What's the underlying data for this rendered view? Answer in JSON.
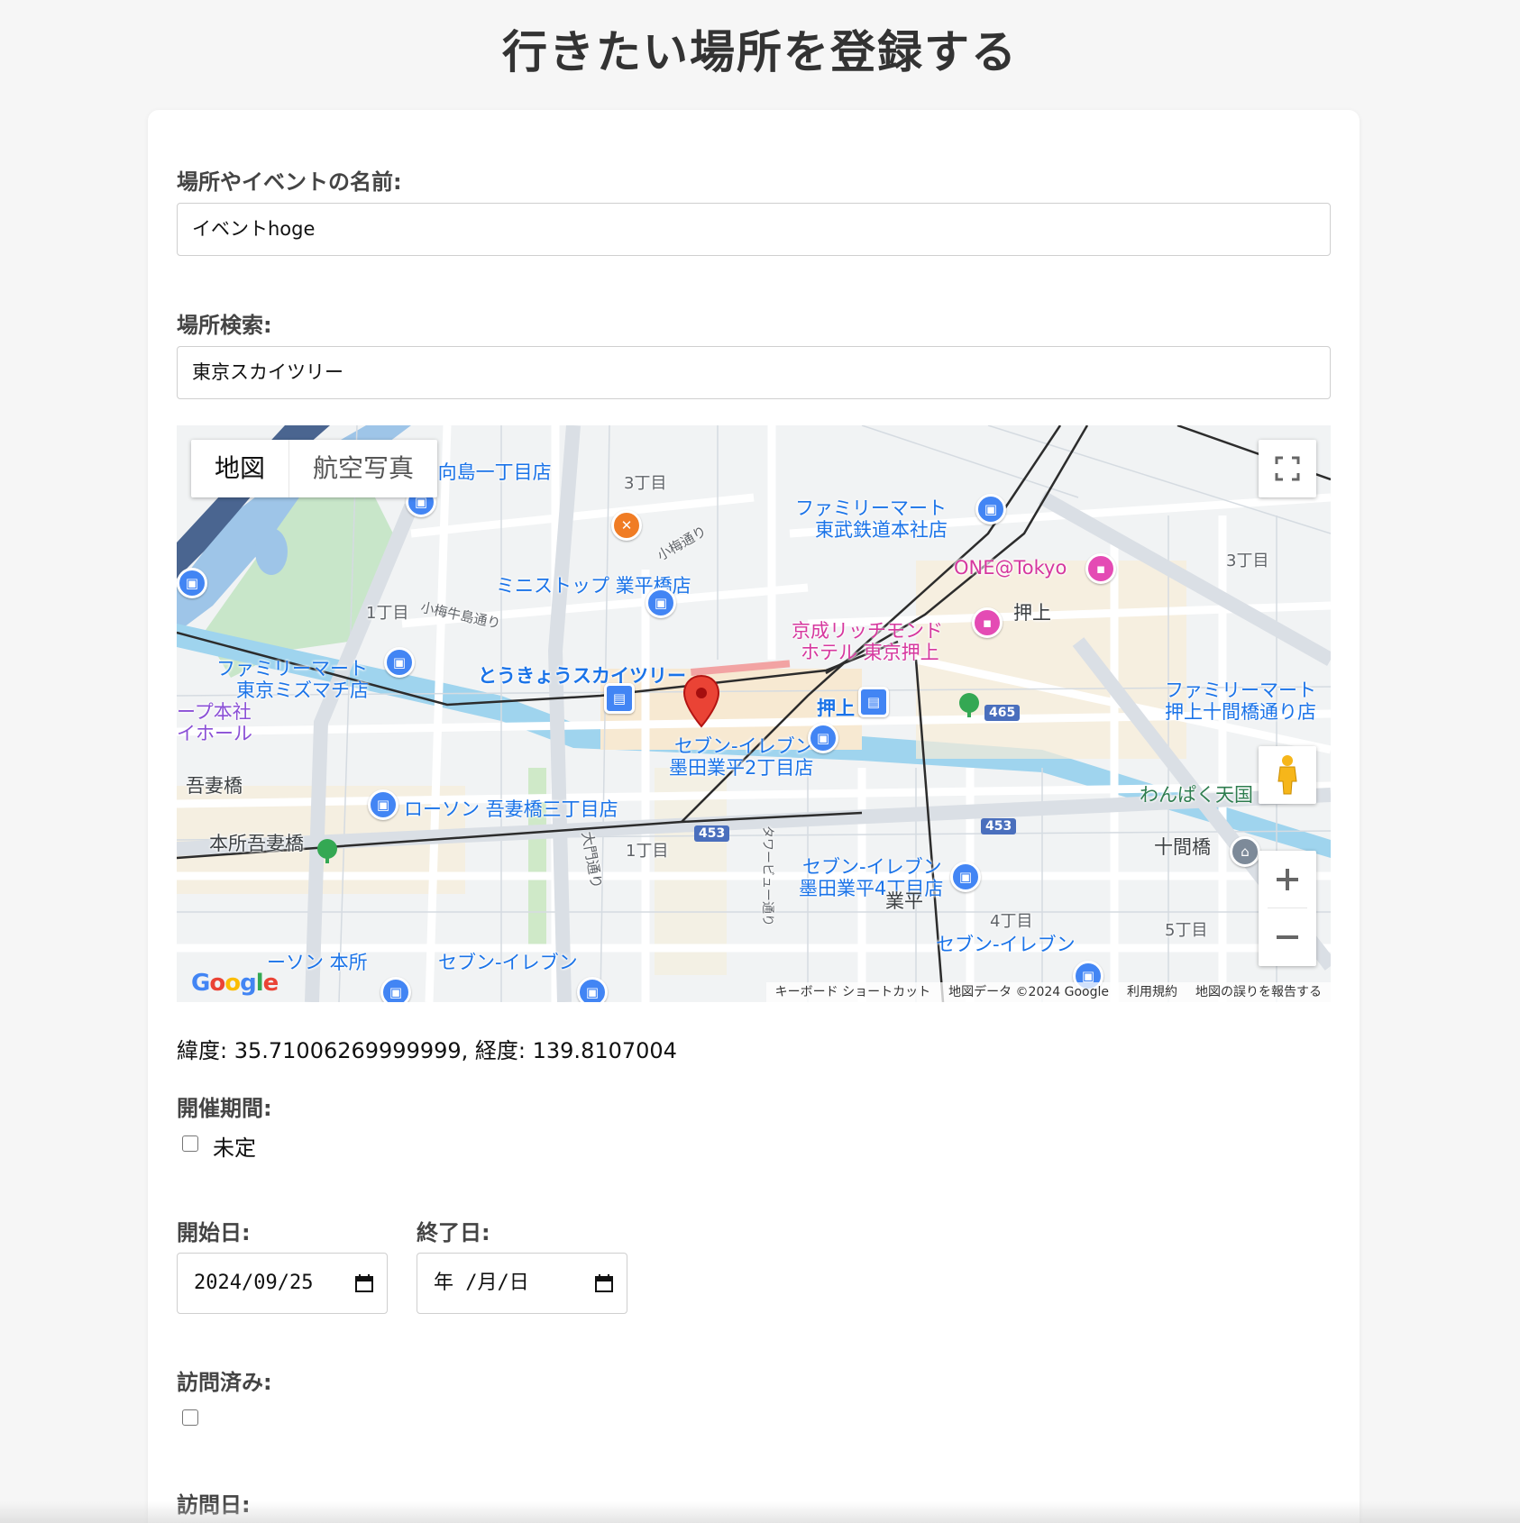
{
  "page": {
    "title": "行きたい場所を登録する"
  },
  "form": {
    "name_label": "場所やイベントの名前:",
    "name_value": "イベントhoge",
    "search_label": "場所検索:",
    "search_value": "東京スカイツリー",
    "coords_text": "緯度: 35.71006269999999, 経度: 139.8107004",
    "period_label": "開催期間:",
    "undecided_label": "未定",
    "start_label": "開始日:",
    "start_value": "2024/09/25",
    "end_label": "終了日:",
    "end_value": "年 /月/日",
    "visited_label": "訪問済み:",
    "visit_date_label": "訪問日:"
  },
  "map": {
    "type_map": "地図",
    "type_satellite": "航空写真",
    "logo": "Google",
    "attribution": {
      "shortcuts": "キーボード ショートカット",
      "data": "地図データ ©2024 Google",
      "terms": "利用規約",
      "report": "地図の誤りを報告する"
    },
    "labels": {
      "mukojima": "ン 向島一丁目店",
      "3chome_a": "3丁目",
      "family_tobu": "ファミリーマート",
      "family_tobu2": "東武鉄道本社店",
      "komume": "小梅通り",
      "ministop": "ミニストップ 業平橋店",
      "one_tokyo": "ONE@Tokyo",
      "3chome_b": "3丁目",
      "1chome_a": "1丁目",
      "komume_ushijima": "小梅牛島通り",
      "keisei1": "京成リッチモンド",
      "keisei2": "ホテル 東京押上",
      "oshiage_area": "押上",
      "family_mizumachi1": "ファミリーマート",
      "family_mizumachi2": "東京ミズマチ店",
      "skytree_station": "とうきょうスカイツリー",
      "honsha1": "ープ本社",
      "honsha2": "イホール",
      "oshiage_station": "押上",
      "family_jukken1": "ファミリーマート",
      "family_jukken2": "押上十間橋通り店",
      "seven_2chome1": "セブン-イレブン",
      "seven_2chome2": "墨田業平2丁目店",
      "azumabashi": "吾妻橋",
      "lawson_azuma": "ローソン 吾妻橋三丁目店",
      "wanpaku": "わんぱく天国",
      "honjo_azumabashi": "本所吾妻橋",
      "1chome_b": "1丁目",
      "daimon": "大門通り",
      "tower_view": "タワービュー通り",
      "seven_4chome1": "セブン-イレブン",
      "seven_4chome2": "墨田業平4丁目店",
      "jukkenbashi": "十間橋",
      "narihira": "業平",
      "4chome": "4丁目",
      "5chome": "5丁目",
      "lawson_honjo": "ーソン 本所",
      "seven_bottom": "セブン-イレブン",
      "seven_bottom2": "セブン-イレブン",
      "route_453a": "453",
      "route_453b": "453",
      "route_465": "465"
    }
  }
}
